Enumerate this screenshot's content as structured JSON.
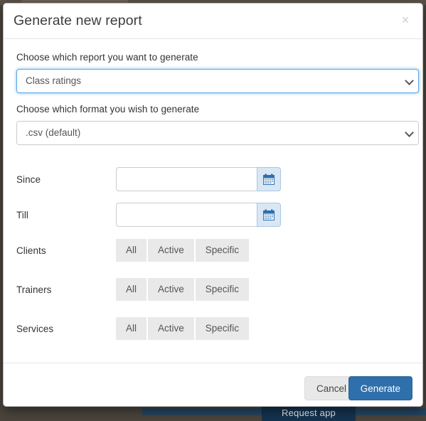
{
  "background": {
    "behind_button_label": "Request app",
    "backdrop_color": "#4a443c",
    "behind_button_color": "#15324e"
  },
  "modal": {
    "title": "Generate new report",
    "close_icon": "close-icon",
    "close_label": "×",
    "accent_color": "#2f6fab",
    "focus_color": "#5ba7e8",
    "fields": {
      "report": {
        "label": "Choose which report you want to generate",
        "value": "Class ratings",
        "options": [
          "Class ratings"
        ],
        "focused": true,
        "caret_icon": "chevron-down-icon"
      },
      "format": {
        "label": "Choose which format you wish to generate",
        "value": ".csv (default)",
        "options": [
          ".csv (default)"
        ],
        "focused": false,
        "caret_icon": "chevron-down-icon"
      },
      "since": {
        "label": "Since",
        "value": "",
        "placeholder": "",
        "calendar_icon": "calendar-icon"
      },
      "till": {
        "label": "Till",
        "value": "",
        "placeholder": "",
        "calendar_icon": "calendar-icon"
      },
      "clients": {
        "label": "Clients",
        "options": [
          "All",
          "Active",
          "Specific"
        ],
        "selected": ""
      },
      "trainers": {
        "label": "Trainers",
        "options": [
          "All",
          "Active",
          "Specific"
        ],
        "selected": ""
      },
      "services": {
        "label": "Services",
        "options": [
          "All",
          "Active",
          "Specific"
        ],
        "selected": ""
      }
    },
    "footer": {
      "cancel_label": "Cancel",
      "generate_label": "Generate"
    }
  }
}
